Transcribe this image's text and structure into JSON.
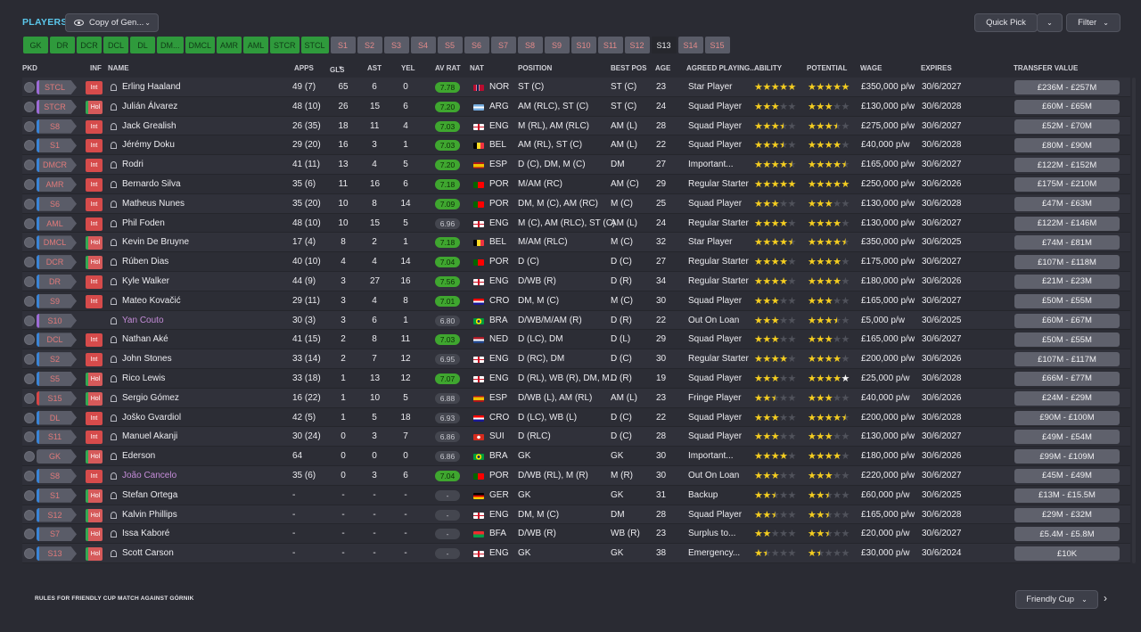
{
  "header": {
    "title": "PLAYERS",
    "view_label": "Copy of Gen...",
    "quick_pick": "Quick Pick",
    "filter": "Filter"
  },
  "position_tabs": [
    "GK",
    "DR",
    "DCR",
    "DCL",
    "DL",
    "DM...",
    "DMCL",
    "AMR",
    "AML",
    "STCR",
    "STCL",
    "S1",
    "S2",
    "S3",
    "S4",
    "S5",
    "S6",
    "S7",
    "S8",
    "S9",
    "S10",
    "S11",
    "S12",
    "S13",
    "S14",
    "S15"
  ],
  "active_tab": "S13",
  "columns": {
    "pkd": "PKD",
    "inf": "INF",
    "name": "NAME",
    "apps": "APPS",
    "gls": "GLS",
    "ast": "AST",
    "yel": "YEL",
    "av_rat": "AV RAT",
    "nat": "NAT",
    "position": "POSITION",
    "best_pos": "BEST POS",
    "age": "AGE",
    "agreed": "AGREED PLAYING...",
    "ability": "ABILITY",
    "potential": "POTENTIAL",
    "wage": "WAGE",
    "expires": "EXPIRES",
    "transfer_value": "TRANSFER VALUE"
  },
  "players": [
    {
      "role": "STCL",
      "inf": "Int",
      "name": "Erling Haaland",
      "apps": "49 (7)",
      "gls": "65",
      "ast": "6",
      "yel": "0",
      "rat": "7.78",
      "nat": "NOR",
      "position": "ST (C)",
      "best": "ST (C)",
      "age": "23",
      "agreed": "Star Player",
      "ability": 5,
      "potential": 5,
      "wage": "£350,000 p/w",
      "expires": "30/6/2027",
      "tv": "£236M - £257M"
    },
    {
      "role": "STCR",
      "inf": "Hol",
      "name": "Julián Álvarez",
      "apps": "48 (10)",
      "gls": "26",
      "ast": "15",
      "yel": "6",
      "rat": "7.20",
      "nat": "ARG",
      "position": "AM (RLC), ST (C)",
      "best": "ST (C)",
      "age": "24",
      "agreed": "Squad Player",
      "ability": 3,
      "potential": 3,
      "wage": "£130,000 p/w",
      "expires": "30/6/2028",
      "tv": "£60M - £65M"
    },
    {
      "role": "S8",
      "inf": "Int",
      "name": "Jack Grealish",
      "apps": "26 (35)",
      "gls": "18",
      "ast": "11",
      "yel": "4",
      "rat": "7.03",
      "nat": "ENG",
      "position": "M (RL), AM (RLC)",
      "best": "AM (L)",
      "age": "28",
      "agreed": "Squad Player",
      "ability": 3.5,
      "potential": 3.5,
      "wage": "£275,000 p/w",
      "expires": "30/6/2027",
      "tv": "£52M - £70M"
    },
    {
      "role": "S1",
      "inf": "Int",
      "name": "Jérémy Doku",
      "apps": "29 (20)",
      "gls": "16",
      "ast": "3",
      "yel": "1",
      "rat": "7.03",
      "nat": "BEL",
      "position": "AM (RL), ST (C)",
      "best": "AM (L)",
      "age": "22",
      "agreed": "Squad Player",
      "ability": 3.5,
      "potential": 4,
      "wage": "£40,000 p/w",
      "expires": "30/6/2028",
      "tv": "£80M - £90M"
    },
    {
      "role": "DMCR",
      "inf": "Int",
      "name": "Rodri",
      "apps": "41 (11)",
      "gls": "13",
      "ast": "4",
      "yel": "5",
      "rat": "7.20",
      "nat": "ESP",
      "position": "D (C), DM, M (C)",
      "best": "DM",
      "age": "27",
      "agreed": "Important...",
      "ability": 4.5,
      "potential": 4.5,
      "wage": "£165,000 p/w",
      "expires": "30/6/2027",
      "tv": "£122M - £152M"
    },
    {
      "role": "AMR",
      "inf": "Int",
      "name": "Bernardo Silva",
      "apps": "35 (6)",
      "gls": "11",
      "ast": "16",
      "yel": "6",
      "rat": "7.18",
      "nat": "POR",
      "position": "M/AM (RC)",
      "best": "AM (C)",
      "age": "29",
      "agreed": "Regular Starter",
      "ability": 5,
      "potential": 5,
      "wage": "£250,000 p/w",
      "expires": "30/6/2026",
      "tv": "£175M - £210M"
    },
    {
      "role": "S6",
      "inf": "Int",
      "name": "Matheus Nunes",
      "apps": "35 (20)",
      "gls": "10",
      "ast": "8",
      "yel": "14",
      "rat": "7.09",
      "nat": "POR",
      "position": "DM, M (C), AM (RC)",
      "best": "M (C)",
      "age": "25",
      "agreed": "Squad Player",
      "ability": 3,
      "potential": 3,
      "wage": "£130,000 p/w",
      "expires": "30/6/2028",
      "tv": "£47M - £63M"
    },
    {
      "role": "AML",
      "inf": "Int",
      "name": "Phil Foden",
      "apps": "48 (10)",
      "gls": "10",
      "ast": "15",
      "yel": "5",
      "rat": "6.96",
      "nat": "ENG",
      "position": "M (C), AM (RLC), ST (C)",
      "best": "AM (L)",
      "age": "24",
      "agreed": "Regular Starter",
      "ability": 4,
      "potential": 4,
      "wage": "£130,000 p/w",
      "expires": "30/6/2027",
      "tv": "£122M - £146M"
    },
    {
      "role": "DMCL",
      "inf": "Hol",
      "name": "Kevin De Bruyne",
      "apps": "17 (4)",
      "gls": "8",
      "ast": "2",
      "yel": "1",
      "rat": "7.18",
      "nat": "BEL",
      "position": "M/AM (RLC)",
      "best": "M (C)",
      "age": "32",
      "agreed": "Star Player",
      "ability": 4.5,
      "potential": 4.5,
      "wage": "£350,000 p/w",
      "expires": "30/6/2025",
      "tv": "£74M - £81M"
    },
    {
      "role": "DCR",
      "inf": "Hol",
      "name": "Rúben Dias",
      "apps": "40 (10)",
      "gls": "4",
      "ast": "4",
      "yel": "14",
      "rat": "7.04",
      "nat": "POR",
      "position": "D (C)",
      "best": "D (C)",
      "age": "27",
      "agreed": "Regular Starter",
      "ability": 4,
      "potential": 4,
      "wage": "£175,000 p/w",
      "expires": "30/6/2027",
      "tv": "£107M - £118M"
    },
    {
      "role": "DR",
      "inf": "Int",
      "name": "Kyle Walker",
      "apps": "44 (9)",
      "gls": "3",
      "ast": "27",
      "yel": "16",
      "rat": "7.56",
      "nat": "ENG",
      "position": "D/WB (R)",
      "best": "D (R)",
      "age": "34",
      "agreed": "Regular Starter",
      "ability": 4,
      "potential": 4,
      "wage": "£180,000 p/w",
      "expires": "30/6/2026",
      "tv": "£21M - £23M"
    },
    {
      "role": "S9",
      "inf": "Int",
      "name": "Mateo Kovačić",
      "apps": "29 (11)",
      "gls": "3",
      "ast": "4",
      "yel": "8",
      "rat": "7.01",
      "nat": "CRO",
      "position": "DM, M (C)",
      "best": "M (C)",
      "age": "30",
      "agreed": "Squad Player",
      "ability": 3,
      "potential": 3,
      "wage": "£165,000 p/w",
      "expires": "30/6/2027",
      "tv": "£50M - £55M"
    },
    {
      "role": "S10",
      "inf": "",
      "name": "Yan Couto",
      "apps": "30 (3)",
      "gls": "3",
      "ast": "6",
      "yel": "1",
      "rat": "6.80",
      "nat": "BRA",
      "position": "D/WB/M/AM (R)",
      "best": "D (R)",
      "age": "22",
      "agreed": "Out On Loan",
      "ability": 3,
      "potential": 3.5,
      "wage": "£5,000 p/w",
      "expires": "30/6/2025",
      "tv": "£60M - £67M",
      "loan": true
    },
    {
      "role": "DCL",
      "inf": "Int",
      "name": "Nathan Aké",
      "apps": "41 (15)",
      "gls": "2",
      "ast": "8",
      "yel": "11",
      "rat": "7.03",
      "nat": "NED",
      "position": "D (LC), DM",
      "best": "D (L)",
      "age": "29",
      "agreed": "Squad Player",
      "ability": 3,
      "potential": 3,
      "wage": "£165,000 p/w",
      "expires": "30/6/2027",
      "tv": "£50M - £55M"
    },
    {
      "role": "S2",
      "inf": "Int",
      "name": "John Stones",
      "apps": "33 (14)",
      "gls": "2",
      "ast": "7",
      "yel": "12",
      "rat": "6.95",
      "nat": "ENG",
      "position": "D (RC), DM",
      "best": "D (C)",
      "age": "30",
      "agreed": "Regular Starter",
      "ability": 4,
      "potential": 4,
      "wage": "£200,000 p/w",
      "expires": "30/6/2026",
      "tv": "£107M - £117M"
    },
    {
      "role": "S5",
      "inf": "Hol",
      "name": "Rico Lewis",
      "apps": "33 (18)",
      "gls": "1",
      "ast": "13",
      "yel": "12",
      "rat": "7.07",
      "nat": "ENG",
      "position": "D (RL), WB (R), DM, M...",
      "best": "D (R)",
      "age": "19",
      "agreed": "Squad Player",
      "ability": 3,
      "potential": 4,
      "potential_white": true,
      "wage": "£25,000 p/w",
      "expires": "30/6/2028",
      "tv": "£66M - £77M"
    },
    {
      "role": "S15",
      "inf": "Hol",
      "name": "Sergio Gómez",
      "apps": "16 (22)",
      "gls": "1",
      "ast": "10",
      "yel": "5",
      "rat": "6.88",
      "nat": "ESP",
      "position": "D/WB (L), AM (RL)",
      "best": "AM (L)",
      "age": "23",
      "agreed": "Fringe Player",
      "ability": 2.5,
      "potential": 3,
      "wage": "£40,000 p/w",
      "expires": "30/6/2026",
      "tv": "£24M - £29M"
    },
    {
      "role": "DL",
      "inf": "Int",
      "name": "Joško Gvardiol",
      "apps": "42 (5)",
      "gls": "1",
      "ast": "5",
      "yel": "18",
      "rat": "6.93",
      "nat": "CRO",
      "position": "D (LC), WB (L)",
      "best": "D (C)",
      "age": "22",
      "agreed": "Squad Player",
      "ability": 3,
      "potential": 4.5,
      "wage": "£200,000 p/w",
      "expires": "30/6/2028",
      "tv": "£90M - £100M"
    },
    {
      "role": "S11",
      "inf": "Int",
      "name": "Manuel Akanji",
      "apps": "30 (24)",
      "gls": "0",
      "ast": "3",
      "yel": "7",
      "rat": "6.86",
      "nat": "SUI",
      "position": "D (RLC)",
      "best": "D (C)",
      "age": "28",
      "agreed": "Squad Player",
      "ability": 3,
      "potential": 3,
      "wage": "£130,000 p/w",
      "expires": "30/6/2027",
      "tv": "£49M - £54M"
    },
    {
      "role": "GK",
      "inf": "Hol",
      "name": "Ederson",
      "apps": "64",
      "gls": "0",
      "ast": "0",
      "yel": "0",
      "rat": "6.86",
      "nat": "BRA",
      "position": "GK",
      "best": "GK",
      "age": "30",
      "agreed": "Important...",
      "ability": 4,
      "potential": 4,
      "wage": "£180,000 p/w",
      "expires": "30/6/2026",
      "tv": "£99M - £109M"
    },
    {
      "role": "S8",
      "inf": "Int",
      "name": "João Cancelo",
      "apps": "35 (6)",
      "gls": "0",
      "ast": "3",
      "yel": "6",
      "rat": "7.04",
      "nat": "POR",
      "position": "D/WB (RL), M (R)",
      "best": "M (R)",
      "age": "30",
      "agreed": "Out On Loan",
      "ability": 3,
      "potential": 3,
      "wage": "£220,000 p/w",
      "expires": "30/6/2027",
      "tv": "£45M - £49M",
      "loan": true
    },
    {
      "role": "S1",
      "inf": "Hol",
      "name": "Stefan Ortega",
      "apps": "-",
      "gls": "-",
      "ast": "-",
      "yel": "-",
      "rat": "-",
      "nat": "GER",
      "position": "GK",
      "best": "GK",
      "age": "31",
      "agreed": "Backup",
      "ability": 2.5,
      "potential": 2.5,
      "wage": "£60,000 p/w",
      "expires": "30/6/2025",
      "tv": "£13M - £15.5M"
    },
    {
      "role": "S12",
      "inf": "Hol",
      "name": "Kalvin Phillips",
      "apps": "-",
      "gls": "-",
      "ast": "-",
      "yel": "-",
      "rat": "-",
      "nat": "ENG",
      "position": "DM, M (C)",
      "best": "DM",
      "age": "28",
      "agreed": "Squad Player",
      "ability": 2.5,
      "potential": 2.5,
      "wage": "£165,000 p/w",
      "expires": "30/6/2028",
      "tv": "£29M - £32M"
    },
    {
      "role": "S7",
      "inf": "Hol",
      "name": "Issa Kaboré",
      "apps": "-",
      "gls": "-",
      "ast": "-",
      "yel": "-",
      "rat": "-",
      "nat": "BFA",
      "position": "D/WB (R)",
      "best": "WB (R)",
      "age": "23",
      "agreed": "Surplus to...",
      "ability": 2,
      "potential": 2.5,
      "wage": "£20,000 p/w",
      "expires": "30/6/2027",
      "tv": "£5.4M - £5.8M"
    },
    {
      "role": "S13",
      "inf": "Hol",
      "name": "Scott Carson",
      "apps": "-",
      "gls": "-",
      "ast": "-",
      "yel": "-",
      "rat": "-",
      "nat": "ENG",
      "position": "GK",
      "best": "GK",
      "age": "38",
      "agreed": "Emergency...",
      "ability": 1.5,
      "potential": 1.5,
      "wage": "£30,000 p/w",
      "expires": "30/6/2024",
      "tv": "£10K"
    }
  ],
  "footer": {
    "rules_text": "RULES FOR FRIENDLY CUP MATCH AGAINST GÓRNIK",
    "competition": "Friendly Cup"
  },
  "colors": {
    "accent": "#5bc8ec",
    "good_rating": "#3fa62f",
    "star": "#f4cd20",
    "loan_name": "#c48cd8"
  }
}
